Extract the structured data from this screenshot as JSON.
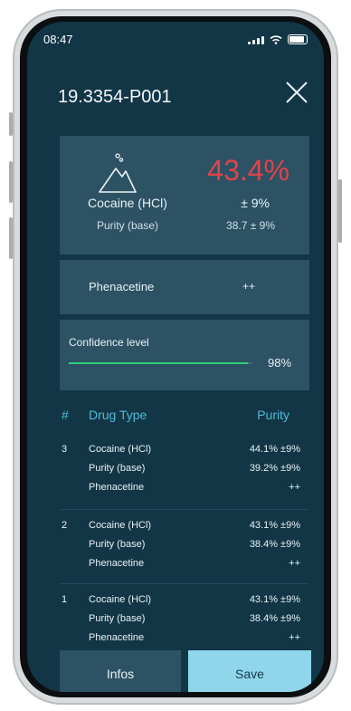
{
  "status_bar": {
    "time": "08:47"
  },
  "header": {
    "title": "19.3354-P001"
  },
  "result": {
    "drug": "Cocaine (HCl)",
    "purity_label": "Purity (base)",
    "percentage": "43.4%",
    "tolerance": "± 9%",
    "base_value": "38.7 ± 9%"
  },
  "adulterant": {
    "name": "Phenacetine",
    "value": "++"
  },
  "confidence": {
    "label": "Confidence level",
    "value": "98%",
    "level": 0.98
  },
  "table": {
    "headers": {
      "number": "#",
      "drug_type": "Drug Type",
      "purity": "Purity"
    },
    "rows": [
      {
        "number": "3",
        "entries": [
          {
            "name": "Cocaine (HCl)",
            "value": "44.1% ±9%"
          },
          {
            "name": "Purity (base)",
            "value": "39.2% ±9%"
          },
          {
            "name": "Phenacetine",
            "value": "++"
          }
        ]
      },
      {
        "number": "2",
        "entries": [
          {
            "name": "Cocaine (HCl)",
            "value": "43.1% ±9%"
          },
          {
            "name": "Purity (base)",
            "value": "38.4% ±9%"
          },
          {
            "name": "Phenacetine",
            "value": "++"
          }
        ]
      },
      {
        "number": "1",
        "entries": [
          {
            "name": "Cocaine (HCl)",
            "value": "43.1% ±9%"
          },
          {
            "name": "Purity (base)",
            "value": "38.4% ±9%"
          },
          {
            "name": "Phenacetine",
            "value": "++"
          }
        ]
      }
    ]
  },
  "buttons": {
    "infos": "Infos",
    "save": "Save"
  },
  "colors": {
    "background": "#123646",
    "card": "#2d5264",
    "accent": "#4fbad7",
    "alert": "#e0434c",
    "progress": "#2ccf78",
    "save": "#8fd6ea"
  }
}
